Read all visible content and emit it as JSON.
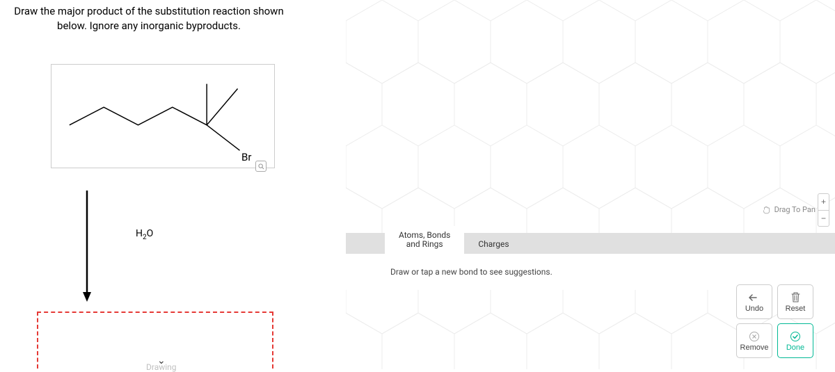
{
  "question": "Draw the major product of the substitution reaction shown below. Ignore any inorganic byproducts.",
  "structure": {
    "atomLabel": "Br"
  },
  "reagent": {
    "text": "H₂O"
  },
  "drawing_label": "Drawing",
  "tabs": {
    "atoms": "Atoms, Bonds\nand Rings",
    "charges": "Charges"
  },
  "hint": "Draw or tap a new bond to see suggestions.",
  "drag_hint": "Drag To Pan",
  "zoom": {
    "plus": "+",
    "minus": "−"
  },
  "buttons": {
    "undo": "Undo",
    "reset": "Reset",
    "remove": "Remove",
    "done": "Done"
  }
}
